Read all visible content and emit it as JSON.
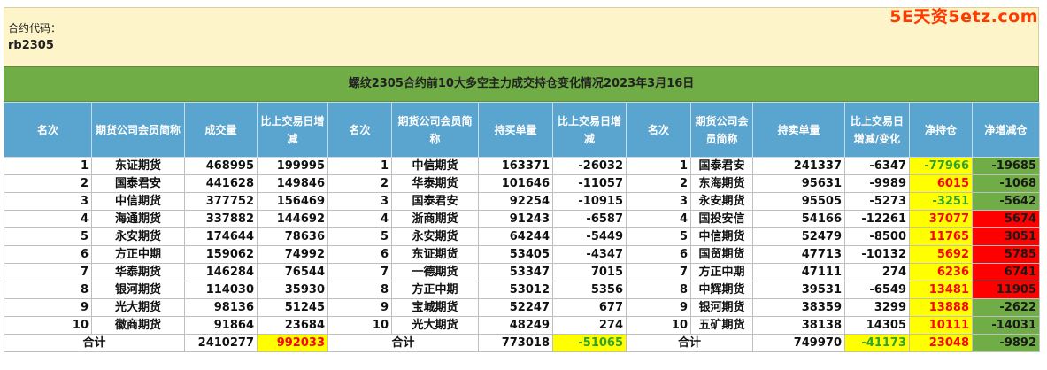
{
  "watermark": "5E天资5etz.com",
  "info": {
    "label": "合约代码：",
    "code": "rb2305"
  },
  "title": "螺纹2305合约前10大多空主力成交持仓变化情况2023年3月16日",
  "headers": [
    "名次",
    "期货公司会员简称",
    "成交量",
    "比上交易日增减",
    "名次",
    "期货公司会员简称",
    "持买单量",
    "比上交易日增减",
    "名次",
    "期货公司会员简称",
    "持卖单量",
    "比上交易日增减/变化",
    "净持仓",
    "净增减仓"
  ],
  "rows": [
    [
      "1",
      "东证期货",
      "468995",
      "199995",
      "1",
      "中信期货",
      "163371",
      "-26032",
      "1",
      "国泰君安",
      "241337",
      "-6347",
      "-77966",
      "-19685"
    ],
    [
      "2",
      "国泰君安",
      "441628",
      "149846",
      "2",
      "华泰期货",
      "101646",
      "-11057",
      "2",
      "东海期货",
      "95631",
      "-9989",
      "6015",
      "-1068"
    ],
    [
      "3",
      "中信期货",
      "377752",
      "156469",
      "3",
      "国泰君安",
      "92254",
      "-10915",
      "3",
      "永安期货",
      "95505",
      "-5273",
      "-3251",
      "-5642"
    ],
    [
      "4",
      "海通期货",
      "337882",
      "144692",
      "4",
      "浙商期货",
      "91243",
      "-6587",
      "4",
      "国投安信",
      "54166",
      "-12261",
      "37077",
      "5674"
    ],
    [
      "5",
      "永安期货",
      "174644",
      "78636",
      "5",
      "永安期货",
      "64244",
      "-5449",
      "5",
      "中信期货",
      "52479",
      "-8500",
      "11765",
      "3051"
    ],
    [
      "6",
      "方正中期",
      "159062",
      "74992",
      "6",
      "东证期货",
      "53405",
      "-4347",
      "6",
      "国贸期货",
      "47713",
      "-10132",
      "5692",
      "5785"
    ],
    [
      "7",
      "华泰期货",
      "146284",
      "76544",
      "7",
      "一德期货",
      "53347",
      "7015",
      "7",
      "方正中期",
      "47111",
      "274",
      "6236",
      "6741"
    ],
    [
      "8",
      "银河期货",
      "114030",
      "35930",
      "8",
      "方正中期",
      "53012",
      "5356",
      "8",
      "中辉期货",
      "39531",
      "-6549",
      "13481",
      "11905"
    ],
    [
      "9",
      "光大期货",
      "98136",
      "51245",
      "9",
      "宝城期货",
      "52247",
      "677",
      "9",
      "银河期货",
      "38359",
      "3299",
      "13888",
      "-2622"
    ],
    [
      "10",
      "徽商期货",
      "91864",
      "23684",
      "10",
      "光大期货",
      "48249",
      "274",
      "10",
      "五矿期货",
      "38138",
      "14305",
      "10111",
      "-14031"
    ]
  ],
  "total": [
    "合计",
    "2410277",
    "992033",
    "合计",
    "773018",
    "-51065",
    "合计",
    "749970",
    "-41173",
    "23048",
    "-9892"
  ],
  "colors": {
    "header_bg": "#5aa5cf",
    "title_bg": "#70ad47",
    "info_bg": "#fdf5c9",
    "highlight_yellow": "#ffff00",
    "positive_red": "#ff0000",
    "negative_green": "#70ad47"
  }
}
